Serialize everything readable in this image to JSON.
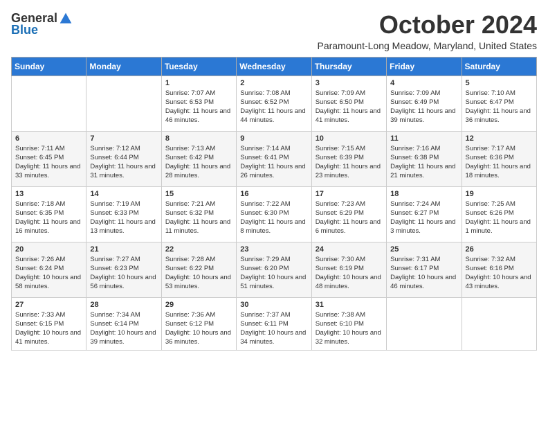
{
  "header": {
    "logo_general": "General",
    "logo_blue": "Blue",
    "month_title": "October 2024",
    "location": "Paramount-Long Meadow, Maryland, United States"
  },
  "days_of_week": [
    "Sunday",
    "Monday",
    "Tuesday",
    "Wednesday",
    "Thursday",
    "Friday",
    "Saturday"
  ],
  "weeks": [
    [
      {
        "day": "",
        "info": ""
      },
      {
        "day": "",
        "info": ""
      },
      {
        "day": "1",
        "info": "Sunrise: 7:07 AM\nSunset: 6:53 PM\nDaylight: 11 hours and 46 minutes."
      },
      {
        "day": "2",
        "info": "Sunrise: 7:08 AM\nSunset: 6:52 PM\nDaylight: 11 hours and 44 minutes."
      },
      {
        "day": "3",
        "info": "Sunrise: 7:09 AM\nSunset: 6:50 PM\nDaylight: 11 hours and 41 minutes."
      },
      {
        "day": "4",
        "info": "Sunrise: 7:09 AM\nSunset: 6:49 PM\nDaylight: 11 hours and 39 minutes."
      },
      {
        "day": "5",
        "info": "Sunrise: 7:10 AM\nSunset: 6:47 PM\nDaylight: 11 hours and 36 minutes."
      }
    ],
    [
      {
        "day": "6",
        "info": "Sunrise: 7:11 AM\nSunset: 6:45 PM\nDaylight: 11 hours and 33 minutes."
      },
      {
        "day": "7",
        "info": "Sunrise: 7:12 AM\nSunset: 6:44 PM\nDaylight: 11 hours and 31 minutes."
      },
      {
        "day": "8",
        "info": "Sunrise: 7:13 AM\nSunset: 6:42 PM\nDaylight: 11 hours and 28 minutes."
      },
      {
        "day": "9",
        "info": "Sunrise: 7:14 AM\nSunset: 6:41 PM\nDaylight: 11 hours and 26 minutes."
      },
      {
        "day": "10",
        "info": "Sunrise: 7:15 AM\nSunset: 6:39 PM\nDaylight: 11 hours and 23 minutes."
      },
      {
        "day": "11",
        "info": "Sunrise: 7:16 AM\nSunset: 6:38 PM\nDaylight: 11 hours and 21 minutes."
      },
      {
        "day": "12",
        "info": "Sunrise: 7:17 AM\nSunset: 6:36 PM\nDaylight: 11 hours and 18 minutes."
      }
    ],
    [
      {
        "day": "13",
        "info": "Sunrise: 7:18 AM\nSunset: 6:35 PM\nDaylight: 11 hours and 16 minutes."
      },
      {
        "day": "14",
        "info": "Sunrise: 7:19 AM\nSunset: 6:33 PM\nDaylight: 11 hours and 13 minutes."
      },
      {
        "day": "15",
        "info": "Sunrise: 7:21 AM\nSunset: 6:32 PM\nDaylight: 11 hours and 11 minutes."
      },
      {
        "day": "16",
        "info": "Sunrise: 7:22 AM\nSunset: 6:30 PM\nDaylight: 11 hours and 8 minutes."
      },
      {
        "day": "17",
        "info": "Sunrise: 7:23 AM\nSunset: 6:29 PM\nDaylight: 11 hours and 6 minutes."
      },
      {
        "day": "18",
        "info": "Sunrise: 7:24 AM\nSunset: 6:27 PM\nDaylight: 11 hours and 3 minutes."
      },
      {
        "day": "19",
        "info": "Sunrise: 7:25 AM\nSunset: 6:26 PM\nDaylight: 11 hours and 1 minute."
      }
    ],
    [
      {
        "day": "20",
        "info": "Sunrise: 7:26 AM\nSunset: 6:24 PM\nDaylight: 10 hours and 58 minutes."
      },
      {
        "day": "21",
        "info": "Sunrise: 7:27 AM\nSunset: 6:23 PM\nDaylight: 10 hours and 56 minutes."
      },
      {
        "day": "22",
        "info": "Sunrise: 7:28 AM\nSunset: 6:22 PM\nDaylight: 10 hours and 53 minutes."
      },
      {
        "day": "23",
        "info": "Sunrise: 7:29 AM\nSunset: 6:20 PM\nDaylight: 10 hours and 51 minutes."
      },
      {
        "day": "24",
        "info": "Sunrise: 7:30 AM\nSunset: 6:19 PM\nDaylight: 10 hours and 48 minutes."
      },
      {
        "day": "25",
        "info": "Sunrise: 7:31 AM\nSunset: 6:17 PM\nDaylight: 10 hours and 46 minutes."
      },
      {
        "day": "26",
        "info": "Sunrise: 7:32 AM\nSunset: 6:16 PM\nDaylight: 10 hours and 43 minutes."
      }
    ],
    [
      {
        "day": "27",
        "info": "Sunrise: 7:33 AM\nSunset: 6:15 PM\nDaylight: 10 hours and 41 minutes."
      },
      {
        "day": "28",
        "info": "Sunrise: 7:34 AM\nSunset: 6:14 PM\nDaylight: 10 hours and 39 minutes."
      },
      {
        "day": "29",
        "info": "Sunrise: 7:36 AM\nSunset: 6:12 PM\nDaylight: 10 hours and 36 minutes."
      },
      {
        "day": "30",
        "info": "Sunrise: 7:37 AM\nSunset: 6:11 PM\nDaylight: 10 hours and 34 minutes."
      },
      {
        "day": "31",
        "info": "Sunrise: 7:38 AM\nSunset: 6:10 PM\nDaylight: 10 hours and 32 minutes."
      },
      {
        "day": "",
        "info": ""
      },
      {
        "day": "",
        "info": ""
      }
    ]
  ]
}
